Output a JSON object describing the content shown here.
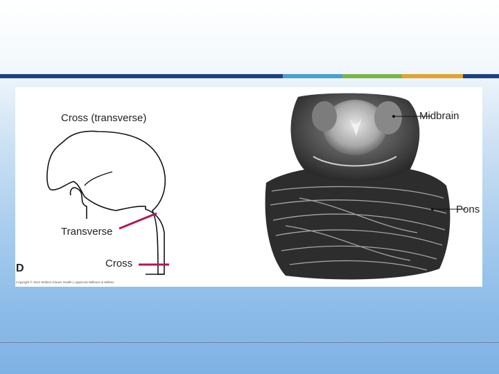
{
  "diagram": {
    "heading": "Cross (transverse)",
    "label_transverse": "Transverse",
    "label_cross": "Cross",
    "panel_letter": "D",
    "copyright": "Copyright © 2012 Wolters Kluwer Health | Lippincott Williams & Wilkins"
  },
  "photo": {
    "label_midbrain": "Midbrain",
    "label_pons": "Pons"
  },
  "colors": {
    "band_navy": "#1e3f8a",
    "band_blue": "#4a9fd8",
    "band_green": "#7ab648",
    "band_gold": "#e0a62c",
    "cut_line": "#b0185a"
  }
}
